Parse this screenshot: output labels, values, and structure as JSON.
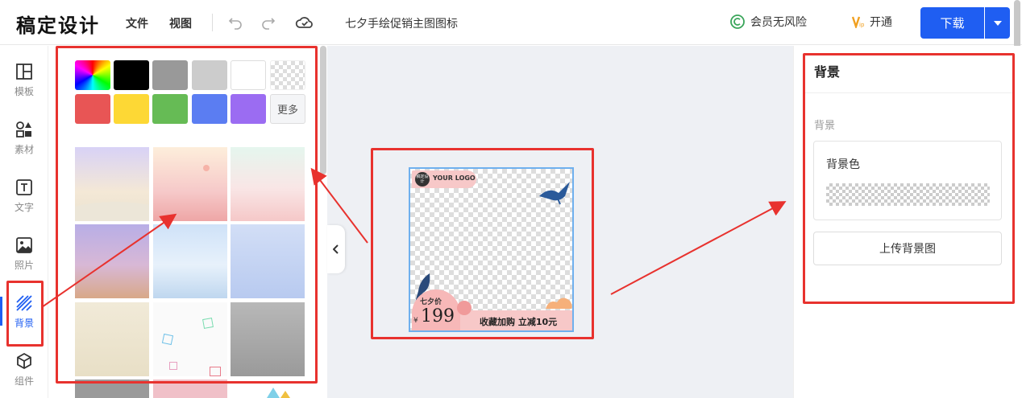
{
  "app": {
    "logo": "稿定设计"
  },
  "header": {
    "menus": [
      "文件",
      "视图"
    ],
    "doc_title": "七夕手绘促销主图图标",
    "member": "会员无风险",
    "open_vip": "开通",
    "download": "下载"
  },
  "rail": {
    "items": [
      {
        "label": "模板",
        "icon": "template-icon"
      },
      {
        "label": "素材",
        "icon": "elements-icon"
      },
      {
        "label": "文字",
        "icon": "text-icon"
      },
      {
        "label": "照片",
        "icon": "photo-icon"
      },
      {
        "label": "背景",
        "icon": "background-icon",
        "active": true
      },
      {
        "label": "组件",
        "icon": "component-icon"
      }
    ]
  },
  "panel": {
    "swatches": [
      "rainbow",
      "#000000",
      "#999999",
      "#cccccc",
      "#ffffff",
      "transparent",
      "#e85555",
      "#fdd835",
      "#66bb55",
      "#5b7df2",
      "#9b6cf2"
    ],
    "more": "更多"
  },
  "poster": {
    "logo_text": "YOUR LOGO",
    "logo_badge": "稿定设计",
    "price_label": "七夕价",
    "currency": "¥",
    "price": "199",
    "promo": "收藏加购 立减10元"
  },
  "right_panel": {
    "title": "背景",
    "section": "背景",
    "color_label": "背景色",
    "upload": "上传背景图"
  },
  "colors": {
    "accent": "#1f5ef2",
    "annotation": "#e8322e"
  }
}
